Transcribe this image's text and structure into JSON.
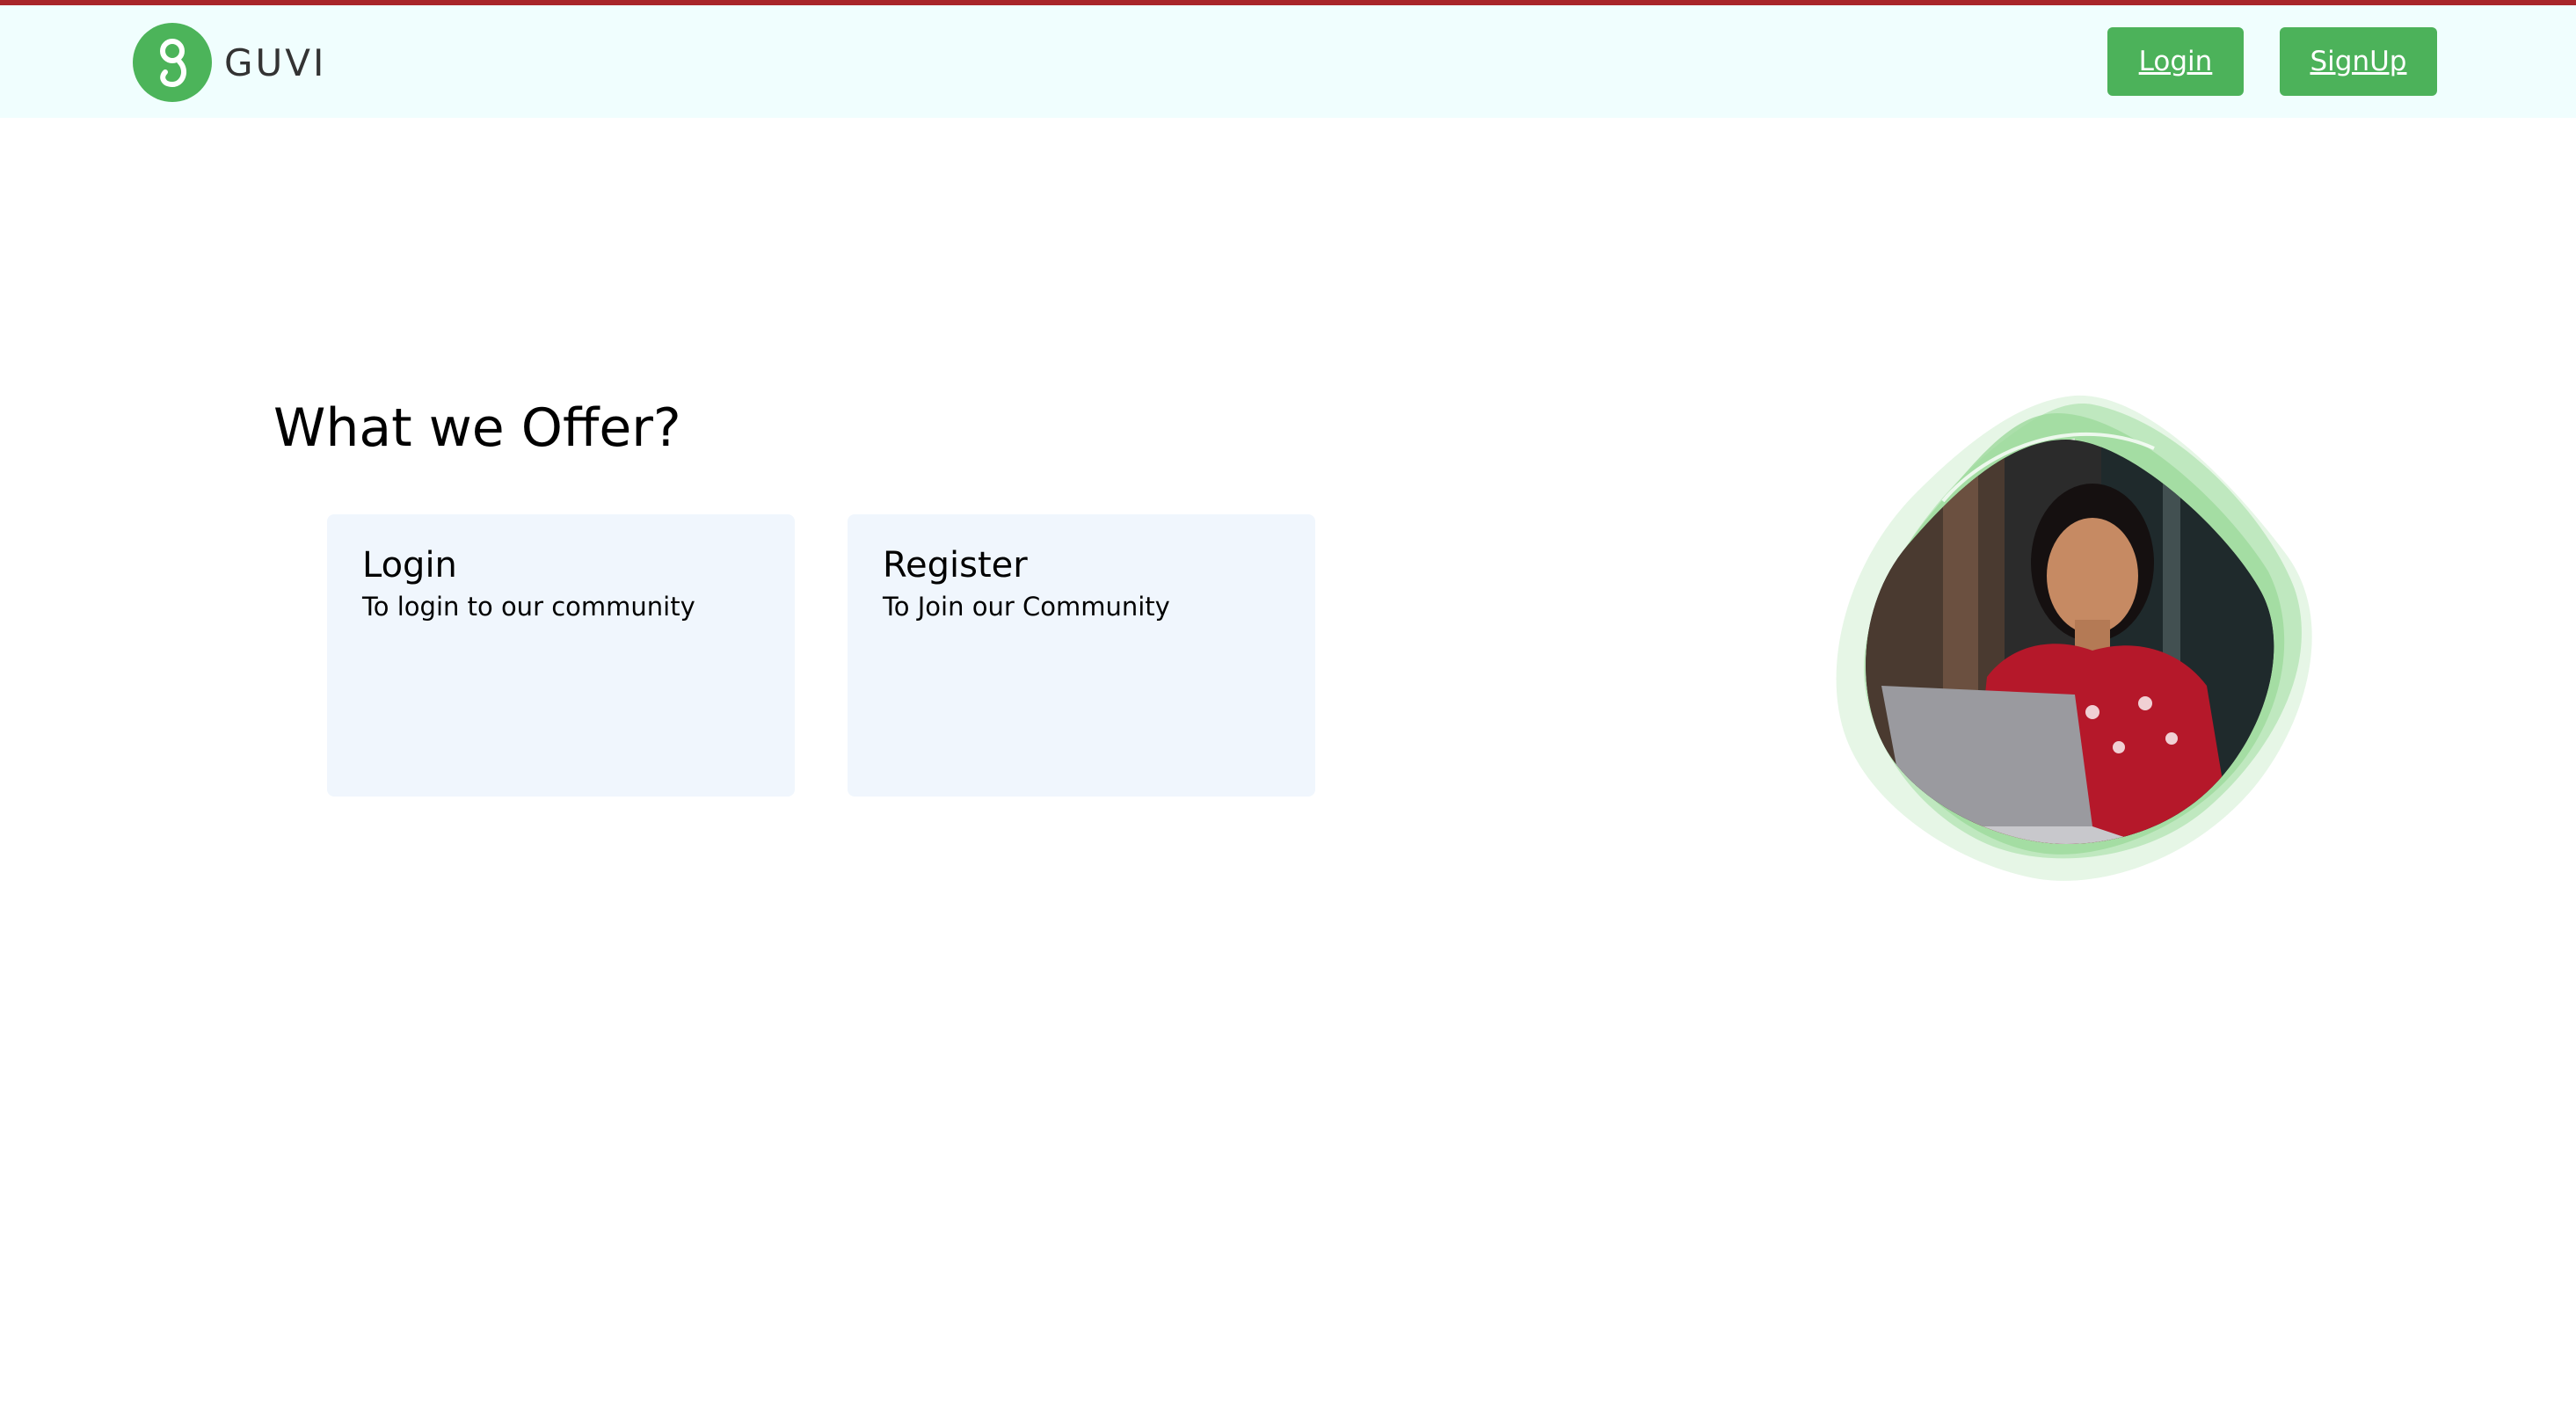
{
  "header": {
    "logo_text": "GUVI",
    "logo_icon": "guvi-logo-icon",
    "login_label": "Login",
    "signup_label": "SignUp"
  },
  "main": {
    "title": "What we Offer?",
    "cards": [
      {
        "title": "Login",
        "description": "To login to our community"
      },
      {
        "title": "Register",
        "description": "To Join our Community"
      }
    ]
  },
  "hero": {
    "image": "woman-with-laptop-illustration"
  },
  "colors": {
    "top_bar": "#a8262a",
    "header_bg": "#f0fefe",
    "brand_green": "#4cb25a",
    "card_bg": "#f0f6fd"
  }
}
